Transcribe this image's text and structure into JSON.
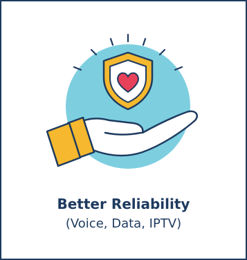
{
  "card": {
    "title": "Better Reliability",
    "subtitle": "(Voice, Data, IPTV)"
  },
  "icons": {
    "main": "hand-holding-shield-heart-icon"
  },
  "colors": {
    "navy": "#1e3a5f",
    "circle": "#7dcfe0",
    "gold": "#f5b82e",
    "heart": "#e8425a",
    "shield_inner": "#ffffff"
  }
}
